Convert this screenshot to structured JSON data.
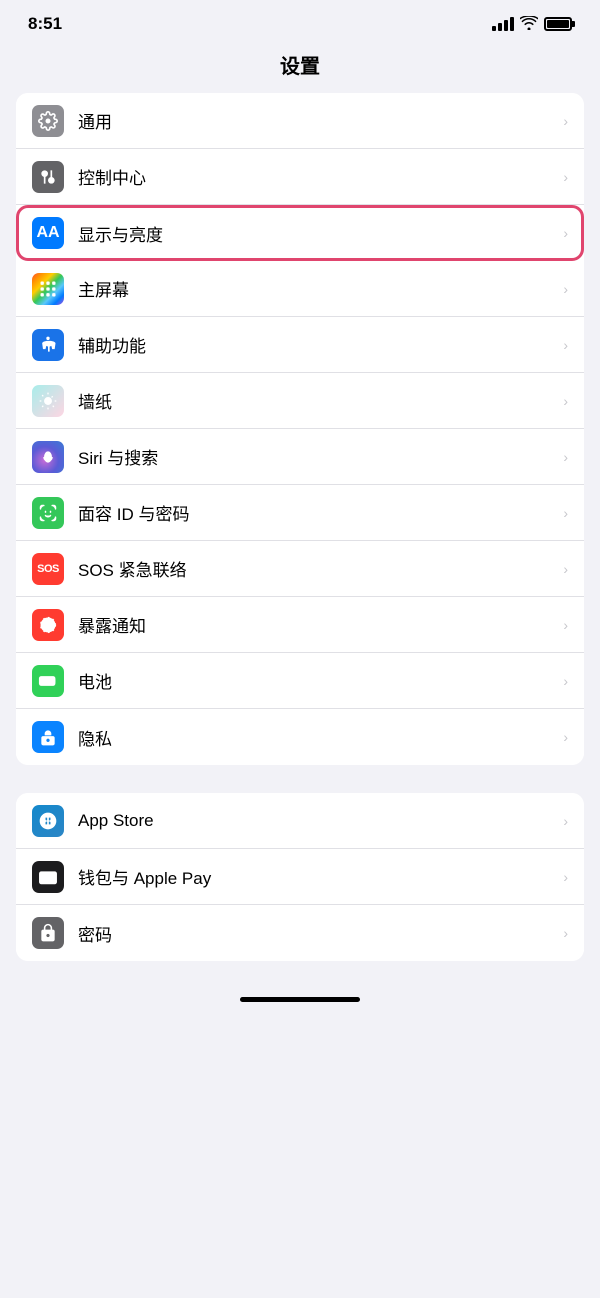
{
  "statusBar": {
    "time": "8:51",
    "signal": "signal",
    "wifi": "wifi",
    "battery": "battery"
  },
  "pageTitle": "设置",
  "groups": [
    {
      "id": "group1",
      "items": [
        {
          "id": "general",
          "label": "通用",
          "iconBg": "icon-gray",
          "icon": "gear",
          "highlighted": false
        },
        {
          "id": "control-center",
          "label": "控制中心",
          "iconBg": "icon-gray2",
          "icon": "sliders",
          "highlighted": false
        },
        {
          "id": "display",
          "label": "显示与亮度",
          "iconBg": "icon-blue",
          "icon": "aa",
          "highlighted": true
        },
        {
          "id": "home-screen",
          "label": "主屏幕",
          "iconBg": "icon-colorful",
          "icon": "grid",
          "highlighted": false
        },
        {
          "id": "accessibility",
          "label": "辅助功能",
          "iconBg": "icon-blue2",
          "icon": "person-circle",
          "highlighted": false
        },
        {
          "id": "wallpaper",
          "label": "墙纸",
          "iconBg": "icon-pink",
          "icon": "flower",
          "highlighted": false
        },
        {
          "id": "siri",
          "label": "Siri 与搜索",
          "iconBg": "icon-siri",
          "icon": "siri",
          "highlighted": false
        },
        {
          "id": "faceid",
          "label": "面容 ID 与密码",
          "iconBg": "icon-green2",
          "icon": "faceid",
          "highlighted": false
        },
        {
          "id": "sos",
          "label": "SOS 紧急联络",
          "iconBg": "icon-red",
          "icon": "sos",
          "highlighted": false
        },
        {
          "id": "exposure",
          "label": "暴露通知",
          "iconBg": "icon-red",
          "icon": "exposure",
          "highlighted": false
        },
        {
          "id": "battery",
          "label": "电池",
          "iconBg": "icon-green3",
          "icon": "battery",
          "highlighted": false
        },
        {
          "id": "privacy",
          "label": "隐私",
          "iconBg": "icon-blue3",
          "icon": "hand",
          "highlighted": false
        }
      ]
    },
    {
      "id": "group2",
      "items": [
        {
          "id": "appstore",
          "label": "App Store",
          "iconBg": "icon-blue4",
          "icon": "appstore",
          "highlighted": false
        },
        {
          "id": "wallet",
          "label": "钱包与 Apple Pay",
          "iconBg": "icon-gray2",
          "icon": "wallet",
          "highlighted": false
        },
        {
          "id": "passwords",
          "label": "密码",
          "iconBg": "icon-gray2",
          "icon": "key",
          "highlighted": false
        }
      ]
    }
  ],
  "homeIndicator": true
}
